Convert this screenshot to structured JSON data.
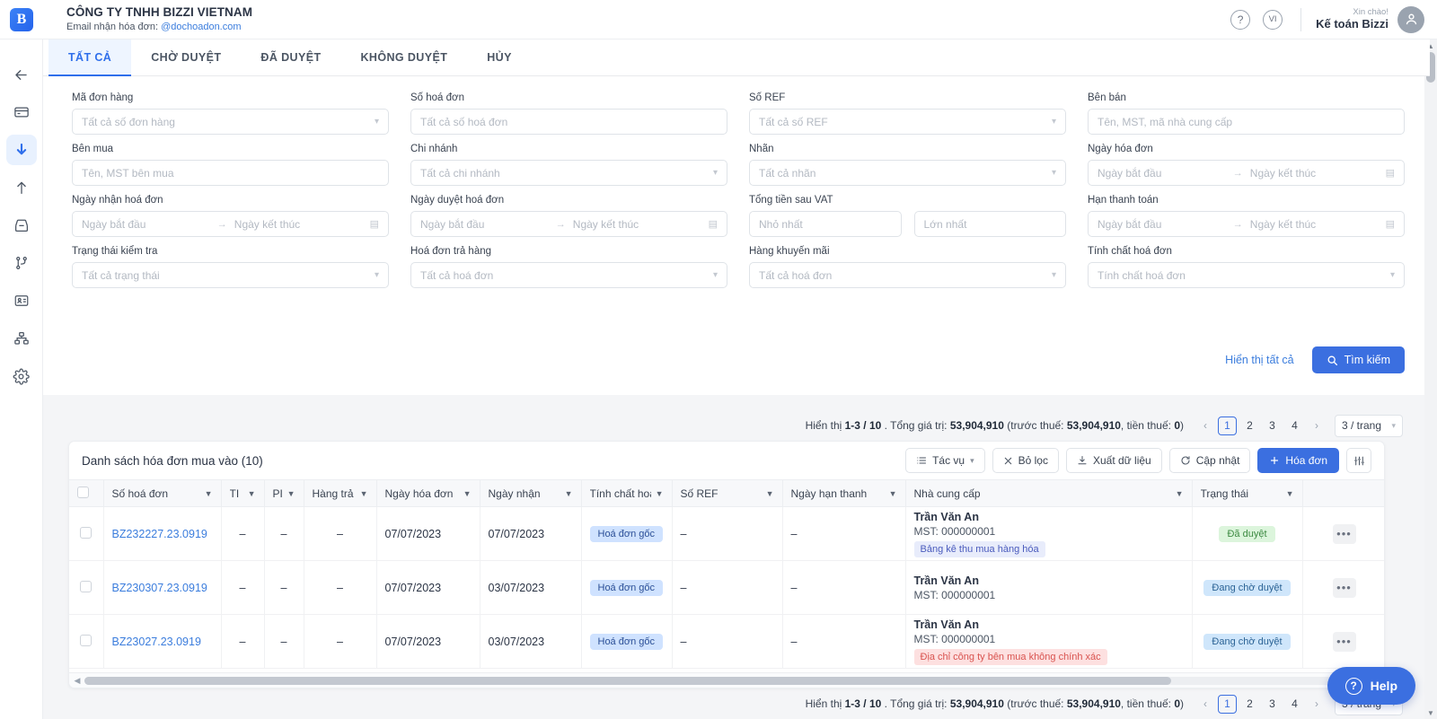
{
  "header": {
    "logo_text": "B",
    "company_name": "CÔNG TY TNHH BIZZI VIETNAM",
    "email_label": "Email nhận hóa đơn:",
    "email_value": "@dochoadon.com",
    "help_icon_label": "?",
    "lang_label": "VI",
    "greeting_small": "Xin chào!",
    "greeting_name": "Kế toán Bizzi"
  },
  "sidebar": {
    "items": [
      {
        "name": "back-arrow-icon",
        "active": false
      },
      {
        "name": "card-icon",
        "active": false
      },
      {
        "name": "download-arrow-icon",
        "active": true
      },
      {
        "name": "upload-arrow-icon",
        "active": false
      },
      {
        "name": "inbox-icon",
        "active": false
      },
      {
        "name": "branch-icon",
        "active": false
      },
      {
        "name": "id-card-icon",
        "active": false
      },
      {
        "name": "sitemap-icon",
        "active": false
      },
      {
        "name": "gear-icon",
        "active": false
      }
    ]
  },
  "tabs": [
    {
      "label": "TẤT CẢ",
      "active": true
    },
    {
      "label": "CHỜ DUYỆT",
      "active": false
    },
    {
      "label": "ĐÃ DUYỆT",
      "active": false
    },
    {
      "label": "KHÔNG DUYỆT",
      "active": false
    },
    {
      "label": "HỦY",
      "active": false
    }
  ],
  "filters": {
    "fields": [
      {
        "label": "Mã đơn hàng",
        "placeholder": "Tất cả số đơn hàng",
        "type": "select"
      },
      {
        "label": "Số hoá đơn",
        "placeholder": "Tất cả số hoá đơn",
        "type": "text"
      },
      {
        "label": "Số REF",
        "placeholder": "Tất cả số REF",
        "type": "select"
      },
      {
        "label": "Bên bán",
        "placeholder": "Tên, MST, mã nhà cung cấp",
        "type": "text"
      },
      {
        "label": "Bên mua",
        "placeholder": "Tên, MST bên mua",
        "type": "text"
      },
      {
        "label": "Chi nhánh",
        "placeholder": "Tất cả chi nhánh",
        "type": "select"
      },
      {
        "label": "Nhãn",
        "placeholder": "Tất cả nhãn",
        "type": "select"
      },
      {
        "label": "Ngày hóa đơn",
        "placeholder": "Ngày bắt đầu",
        "placeholder2": "Ngày kết thúc",
        "type": "daterange"
      },
      {
        "label": "Ngày nhận hoá đơn",
        "placeholder": "Ngày bắt đầu",
        "placeholder2": "Ngày kết thúc",
        "type": "daterange"
      },
      {
        "label": "Ngày duyệt hoá đơn",
        "placeholder": "Ngày bắt đầu",
        "placeholder2": "Ngày kết thúc",
        "type": "daterange"
      },
      {
        "label": "Tổng tiền sau VAT",
        "placeholder": "Nhỏ nhất",
        "placeholder2": "Lớn nhất",
        "type": "numrange"
      },
      {
        "label": "Hạn thanh toán",
        "placeholder": "Ngày bắt đầu",
        "placeholder2": "Ngày kết thúc",
        "type": "daterange"
      },
      {
        "label": "Trạng thái kiểm tra",
        "placeholder": "Tất cả trạng thái",
        "type": "select"
      },
      {
        "label": "Hoá đơn trả hàng",
        "placeholder": "Tất cả hoá đơn",
        "type": "select"
      },
      {
        "label": "Hàng khuyến mãi",
        "placeholder": "Tất cả hoá đơn",
        "type": "select"
      },
      {
        "label": "Tính chất hoá đơn",
        "placeholder": "Tính chất hoá đơn",
        "type": "select"
      }
    ],
    "show_all_label": "Hiển thị tất cả",
    "search_label": "Tìm kiếm"
  },
  "pagination": {
    "prefix": "Hiển thị",
    "range": "1-3 / 10",
    "total_label": ". Tổng giá trị:",
    "total_value": "53,904,910",
    "before_tax_label": "(trước thuế:",
    "before_tax_value": "53,904,910",
    "tax_label": ", tiền thuế:",
    "tax_value": "0",
    "close_paren": ")",
    "prev": "‹",
    "next": "›",
    "pages": [
      "1",
      "2",
      "3",
      "4"
    ],
    "active_page": "1",
    "page_size": "3 / trang"
  },
  "table": {
    "title": "Danh sách hóa đơn mua vào (10)",
    "actions": {
      "tasks": "Tác vụ",
      "clear_filter": "Bỏ lọc",
      "export": "Xuất dữ liệu",
      "refresh": "Cập nhật",
      "add_invoice": "Hóa đơn",
      "settings_icon": "column-settings-icon"
    },
    "columns": [
      {
        "label": "",
        "key": "check"
      },
      {
        "label": "Số hoá đơn",
        "sortable": true
      },
      {
        "label": "TI",
        "sortable": true
      },
      {
        "label": "PI",
        "sortable": true
      },
      {
        "label": "Hàng trả",
        "sortable": true
      },
      {
        "label": "Ngày hóa đơn",
        "sortable": true
      },
      {
        "label": "Ngày nhận",
        "sortable": true
      },
      {
        "label": "Tính chất hoá",
        "sortable": true
      },
      {
        "label": "Số REF",
        "sortable": true
      },
      {
        "label": "Ngày hạn thanh",
        "sortable": true
      },
      {
        "label": "Nhà cung cấp",
        "sortable": true
      },
      {
        "label": "Trạng thái",
        "sortable": true
      },
      {
        "label": "",
        "key": "menu"
      }
    ],
    "rows": [
      {
        "invoice_no": "BZ232227.23.0919",
        "ti": "–",
        "pi": "–",
        "returned": "–",
        "invoice_date": "07/07/2023",
        "received_date": "07/07/2023",
        "nature": "Hoá đơn gốc",
        "ref": "–",
        "due_date": "–",
        "supplier_name": "Trần Văn An",
        "supplier_mst": "MST: 000000001",
        "supplier_tag": "Bảng kê thu mua hàng hóa",
        "supplier_tag_type": "purple",
        "status": "Đã duyệt",
        "status_type": "green"
      },
      {
        "invoice_no": "BZ230307.23.0919",
        "ti": "–",
        "pi": "–",
        "returned": "–",
        "invoice_date": "07/07/2023",
        "received_date": "03/07/2023",
        "nature": "Hoá đơn gốc",
        "ref": "–",
        "due_date": "–",
        "supplier_name": "Trần Văn An",
        "supplier_mst": "MST: 000000001",
        "supplier_tag": "",
        "supplier_tag_type": "none",
        "status": "Đang chờ duyệt",
        "status_type": "lightblue"
      },
      {
        "invoice_no": "BZ23027.23.0919",
        "ti": "–",
        "pi": "–",
        "returned": "–",
        "invoice_date": "07/07/2023",
        "received_date": "03/07/2023",
        "nature": "Hoá đơn gốc",
        "ref": "–",
        "due_date": "–",
        "supplier_name": "Trần Văn An",
        "supplier_mst": "MST: 000000001",
        "supplier_tag": "Địa chỉ công ty bên mua không chính xác",
        "supplier_tag_type": "red",
        "status": "Đang chờ duyệt",
        "status_type": "lightblue"
      }
    ]
  },
  "help_widget": {
    "label": "Help",
    "icon": "question-circle-icon"
  },
  "colors": {
    "accent": "#3b6fe0",
    "link": "#3b7ddd",
    "tab_active_bg": "#eef5ff",
    "status_green": "#dcf5dc",
    "status_blue": "#cfe6fb",
    "chip_blue": "#cfe2ff",
    "tag_red": "#fde0e0",
    "tag_purple": "#e8ecfb"
  }
}
